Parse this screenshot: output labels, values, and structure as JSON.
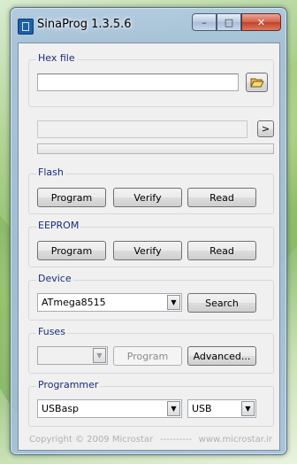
{
  "window": {
    "title": "SinaProg 1.3.5.6"
  },
  "caption": {
    "minimize": "–",
    "maximize": "□",
    "close": "✕"
  },
  "hex_file": {
    "label": "Hex file",
    "path": "",
    "browse_icon": "open-folder-icon"
  },
  "status": {
    "text": "",
    "go_label": ">",
    "progress": 0
  },
  "flash": {
    "label": "Flash",
    "program": "Program",
    "verify": "Verify",
    "read": "Read"
  },
  "eeprom": {
    "label": "EEPROM",
    "program": "Program",
    "verify": "Verify",
    "read": "Read"
  },
  "device": {
    "label": "Device",
    "selected": "ATmega8515",
    "search": "Search"
  },
  "fuses": {
    "label": "Fuses",
    "selected": "",
    "program": "Program",
    "advanced": "Advanced..."
  },
  "programmer": {
    "label": "Programmer",
    "selected": "USBasp",
    "port": "USB"
  },
  "footer": {
    "copyright": "Copyright © 2009 Microstar",
    "dashes": "----------",
    "url": "www.microstar.ir"
  },
  "colors": {
    "group_label": "#1c2c7a",
    "close_button": "#c1412b"
  }
}
